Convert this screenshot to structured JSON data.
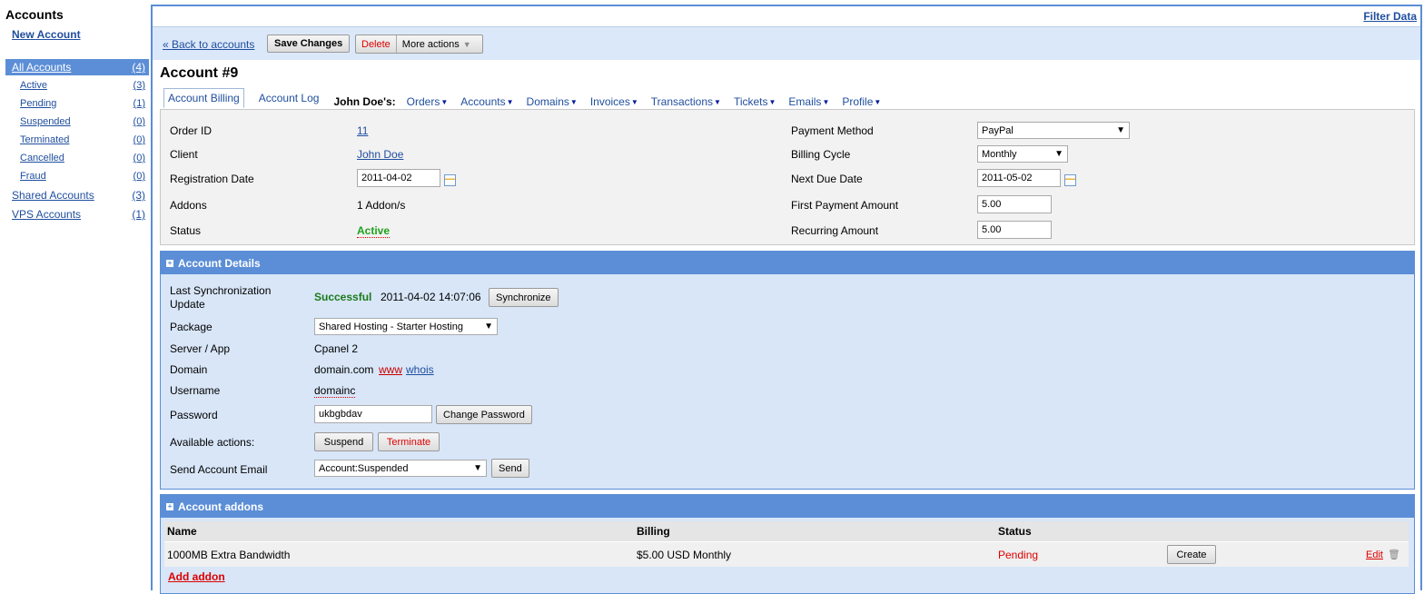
{
  "sidebar": {
    "title": "Accounts",
    "new_account": "New Account",
    "items": [
      {
        "label": "All Accounts",
        "count": "(4)"
      },
      {
        "label": "Active",
        "count": "(3)"
      },
      {
        "label": "Pending",
        "count": "(1)"
      },
      {
        "label": "Suspended",
        "count": "(0)"
      },
      {
        "label": "Terminated",
        "count": "(0)"
      },
      {
        "label": "Cancelled",
        "count": "(0)"
      },
      {
        "label": "Fraud",
        "count": "(0)"
      },
      {
        "label": "Shared Accounts",
        "count": "(3)"
      },
      {
        "label": "VPS Accounts",
        "count": "(1)"
      }
    ]
  },
  "topbar": {
    "filter_data": "Filter Data"
  },
  "toolbar": {
    "back": "« Back to accounts",
    "save": "Save Changes",
    "delete": "Delete",
    "more_actions": "More actions"
  },
  "account": {
    "title": "Account #9"
  },
  "tabs": {
    "billing": "Account Billing",
    "log": "Account Log",
    "owner": "John Doe's:",
    "menus": [
      "Orders",
      "Accounts",
      "Domains",
      "Invoices",
      "Transactions",
      "Tickets",
      "Emails",
      "Profile"
    ]
  },
  "billing": {
    "order_id_label": "Order ID",
    "order_id": "11",
    "client_label": "Client",
    "client": "John Doe",
    "reg_date_label": "Registration Date",
    "reg_date": "2011-04-02",
    "addons_label": "Addons",
    "addons": "1 Addon/s",
    "status_label": "Status",
    "status": "Active",
    "payment_method_label": "Payment Method",
    "payment_method": "PayPal",
    "billing_cycle_label": "Billing Cycle",
    "billing_cycle": "Monthly",
    "next_due_label": "Next Due Date",
    "next_due": "2011-05-02",
    "first_payment_label": "First Payment Amount",
    "first_payment": "5.00",
    "recurring_label": "Recurring Amount",
    "recurring": "5.00"
  },
  "details": {
    "header": "Account Details",
    "sync_label": "Last Synchronization Update",
    "sync_status": "Successful",
    "sync_time": "2011-04-02 14:07:06",
    "synchronize": "Synchronize",
    "package_label": "Package",
    "package": "Shared Hosting - Starter Hosting",
    "server_label": "Server / App",
    "server": "Cpanel 2",
    "domain_label": "Domain",
    "domain": "domain.com",
    "www": "www",
    "whois": "whois",
    "username_label": "Username",
    "username": "domainc",
    "password_label": "Password",
    "password": "ukbgbdav",
    "change_password": "Change Password",
    "actions_label": "Available actions:",
    "suspend": "Suspend",
    "terminate": "Terminate",
    "email_label": "Send Account Email",
    "email_template": "Account:Suspended",
    "send": "Send"
  },
  "addons": {
    "header": "Account addons",
    "columns": {
      "name": "Name",
      "billing": "Billing",
      "status": "Status"
    },
    "rows": [
      {
        "name": "1000MB Extra Bandwidth",
        "billing": "$5.00 USD Monthly",
        "status": "Pending",
        "create": "Create",
        "edit": "Edit"
      }
    ],
    "add_addon": "Add addon"
  },
  "colors": {
    "accent": "#5b8ed6",
    "panel_bg": "#d8e6f8",
    "active_green": "#1da21d",
    "danger_red": "#dd0000"
  }
}
